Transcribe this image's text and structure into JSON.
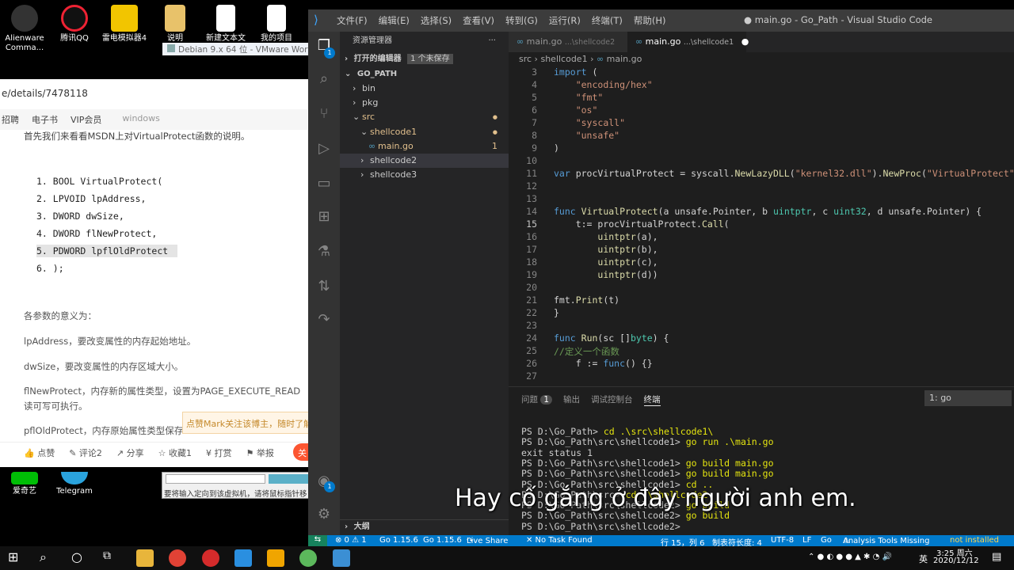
{
  "desktop": {
    "icons": [
      {
        "label": "Alienware Comma...",
        "color": "#222"
      },
      {
        "label": "腾讯QQ",
        "color": "#111"
      },
      {
        "label": "雷电模拟器4",
        "color": "#f2c500"
      },
      {
        "label": "说明",
        "color": "#e8c26a"
      },
      {
        "label": "新建文本文",
        "color": "#fff"
      },
      {
        "label": "我的项目",
        "color": "#fff"
      }
    ],
    "bottom_icons": [
      {
        "label": "爱奇艺"
      },
      {
        "label": "Telegram"
      }
    ],
    "vmware_title": "Debian 9.x 64 位 - VMware Works",
    "vmware_hint": "要将输入定向到该虚拟机，请将鼠标指针移"
  },
  "browser": {
    "url": "e/details/7478118",
    "nav": [
      "招聘",
      "电子书",
      "VIP会员"
    ],
    "search": "windows",
    "intro": "首先我们来看看MSDN上对VirtualProtect函数的说明。",
    "code": [
      "1. BOOL VirtualProtect(",
      "2.   LPVOID lpAddress,",
      "3.   DWORD dwSize,",
      "4.   DWORD flNewProtect,",
      "5.   PDWORD lpflOldProtect",
      "6. );"
    ],
    "params_heading": "各参数的意义为：",
    "params": [
      "lpAddress，要改变属性的内存起始地址。",
      "dwSize，要改变属性的内存区域大小。",
      "flNewProtect，内存新的属性类型，设置为PAGE_EXECUTE_READ",
      "读可写可执行。",
      "pflOldProtect，内存原始属性类型保存"
    ],
    "tooltip": "点赞Mark关注该博主，随时了解TA",
    "actions": [
      "点赞",
      "评论2",
      "分享",
      "收藏1",
      "打赏",
      "举报"
    ],
    "orange": "关"
  },
  "vscode": {
    "title": "● main.go - Go_Path - Visual Studio Code",
    "menus": [
      "文件(F)",
      "编辑(E)",
      "选择(S)",
      "查看(V)",
      "转到(G)",
      "运行(R)",
      "终端(T)",
      "帮助(H)"
    ],
    "explorer_title": "资源管理器",
    "open_editors": "打开的编辑器",
    "unsaved": "1 个未保存",
    "root": "GO_PATH",
    "tree": [
      {
        "label": "bin",
        "indent": 0,
        "arrow": "›",
        "color": "#ccc"
      },
      {
        "label": "pkg",
        "indent": 0,
        "arrow": "›",
        "color": "#ccc"
      },
      {
        "label": "src",
        "indent": 0,
        "arrow": "⌄",
        "color": "#e2c08d",
        "dot": true
      },
      {
        "label": "shellcode1",
        "indent": 1,
        "arrow": "⌄",
        "color": "#e2c08d",
        "dot": true
      },
      {
        "label": "main.go",
        "indent": 2,
        "arrow": "",
        "color": "#e2c08d",
        "count": "1",
        "icon": "go"
      },
      {
        "label": "shellcode2",
        "indent": 1,
        "arrow": "›",
        "color": "#ccc",
        "selected": true
      },
      {
        "label": "shellcode3",
        "indent": 1,
        "arrow": "›",
        "color": "#ccc"
      }
    ],
    "outline": "大纲",
    "tabs": [
      {
        "label": "main.go",
        "path": "...\\shellcode2"
      },
      {
        "label": "main.go",
        "path": "...\\shellcode1"
      }
    ],
    "breadcrumb": [
      "src",
      "shellcode1",
      "main.go"
    ],
    "lines": [
      "3",
      "4",
      "5",
      "6",
      "7",
      "8",
      "9",
      "10",
      "11",
      "12",
      "13",
      "14",
      "15",
      "16",
      "17",
      "18",
      "19",
      "20",
      "21",
      "22",
      "23",
      "24",
      "25",
      "26",
      "27",
      "28"
    ],
    "current_line": "15",
    "panel_tabs": [
      "问题",
      "输出",
      "调试控制台",
      "终端"
    ],
    "problems_count": "1",
    "terminal_select": "1: go",
    "terminal": [
      {
        "p": "PS D:\\Go_Path> ",
        "c": "cd .\\src\\shellcode1\\"
      },
      {
        "p": "PS D:\\Go_Path\\src\\shellcode1> ",
        "c": "go run .\\main.go"
      },
      {
        "p": "exit status 1",
        "c": ""
      },
      {
        "p": "PS D:\\Go_Path\\src\\shellcode1> ",
        "c": "go build main.go"
      },
      {
        "p": "PS D:\\Go_Path\\src\\shellcode1> ",
        "c": "go build main.go"
      },
      {
        "p": "PS D:\\Go_Path\\src\\shellcode1> ",
        "c": "cd .."
      },
      {
        "p": "PS D:\\Go_Path\\src> ",
        "c": "cd .\\shellcode2"
      },
      {
        "p": "PS D:\\Go_Path\\src\\shellcode2> ",
        "c": "go build"
      },
      {
        "p": "PS D:\\Go_Path\\src\\shellcode2> ",
        "c": "go build"
      },
      {
        "p": "PS D:\\Go_Path\\src\\shellcode2> ",
        "c": ""
      }
    ],
    "status": {
      "errors": "⊗ 0 ⚠ 1",
      "go1": "Go 1.15.6",
      "go2": "Go 1.15.6",
      "liveshare": "Live Share",
      "task": "✕ No Task Found",
      "pos": "行 15，列 6",
      "tab": "制表符长度: 4",
      "enc": "UTF-8",
      "eol": "LF",
      "lang": "Go",
      "tools": "Analysis Tools Missing",
      "notinst": "not installed"
    }
  },
  "subtitle": "Hay cố gắng ở đây người anh em.",
  "taskbar": {
    "ime": "英",
    "time": "3:25 周六",
    "date": "2020/12/12",
    "colors": [
      "#ffffff",
      "#ffffff",
      "#ffffff",
      "#e8b53b",
      "#e14235",
      "#d42b2b",
      "#2a8fe0",
      "#1a8ad4",
      "#5cb85c",
      "#3b8fd4"
    ]
  }
}
